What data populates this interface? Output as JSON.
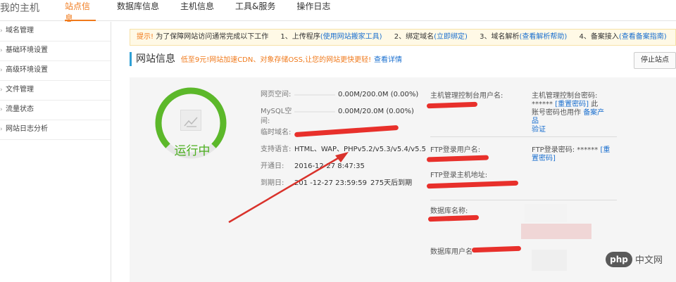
{
  "header": {
    "title": "我的主机",
    "tabs": [
      {
        "label": "站点信息"
      },
      {
        "label": "数据库信息"
      },
      {
        "label": "主机信息"
      },
      {
        "label": "工具&服务"
      },
      {
        "label": "操作日志"
      }
    ]
  },
  "sidebar": {
    "items": [
      {
        "label": "域名管理"
      },
      {
        "label": "基础环境设置"
      },
      {
        "label": "高级环境设置"
      },
      {
        "label": "文件管理"
      },
      {
        "label": "流量状态"
      },
      {
        "label": "网站日志分析"
      }
    ]
  },
  "notice": {
    "tip": "提示!",
    "text": "为了保障网站访问通常完成以下工作",
    "step1": "1、上传程序",
    "step1_link": "(使用网站搬家工具)",
    "step2": "2、绑定域名",
    "step2_link": "(立即绑定)",
    "step3": "3、域名解析",
    "step3_link": "(查看解析帮助)",
    "step4": "4、备案接入",
    "step4_link": "(查看备案指南)"
  },
  "site": {
    "title": "网站信息",
    "promo": "低至9元!网站加速CDN、对象存储OSS,让您的网站更快更轻!",
    "detail_link": "查看详情",
    "stop_button": "停止站点",
    "status": "运行中",
    "status_level": 0.75
  },
  "info": {
    "web_space_label": "网页空间:",
    "web_space_value": "0.00M/200.0M (0.00%)",
    "mysql_label_1": "MySQL空",
    "mysql_label_2": "间:",
    "mysql_value": "0.00M/20.0M (0.00%)",
    "temp_domain_label": "临时域名:",
    "lang_label": "支持语言:",
    "lang_value": "HTML、WAP、PHPv5.2/v5.3/v5.4/v5.5",
    "open_label": "开通日:",
    "open_value": "2016-12-27 8:47:35",
    "expire_label": "到期日:",
    "expire_value": "201 -12-27 23:59:59",
    "expire_days": "275天后到期"
  },
  "host": {
    "console_user_label": "主机管理控制台用户名:",
    "console_pwd_label": "主机管理控制台密码:",
    "console_pwd_value": "******",
    "reset_link": "[重置密码]",
    "pwd_note_1": "此",
    "pwd_note_2": "账号密码也用作",
    "pwd_note_link": "备案产品",
    "pwd_note_3": "验证",
    "ftp_user_label": "FTP登录用户名:",
    "ftp_pwd_label": "FTP登录密码:",
    "ftp_pwd_value": "******",
    "ftp_reset_1": "[重",
    "ftp_reset_2": "置密码]",
    "ftp_host_label": "FTP登录主机地址:",
    "db_name_label": "数据库名称:",
    "db_user_label": "数据库用户名"
  },
  "watermark": {
    "badge": "php",
    "site": "中文网"
  },
  "colors": {
    "accent": "#f07a1c",
    "link": "#1a6fcf",
    "running": "#4caf20",
    "redaction": "#e8302b"
  }
}
